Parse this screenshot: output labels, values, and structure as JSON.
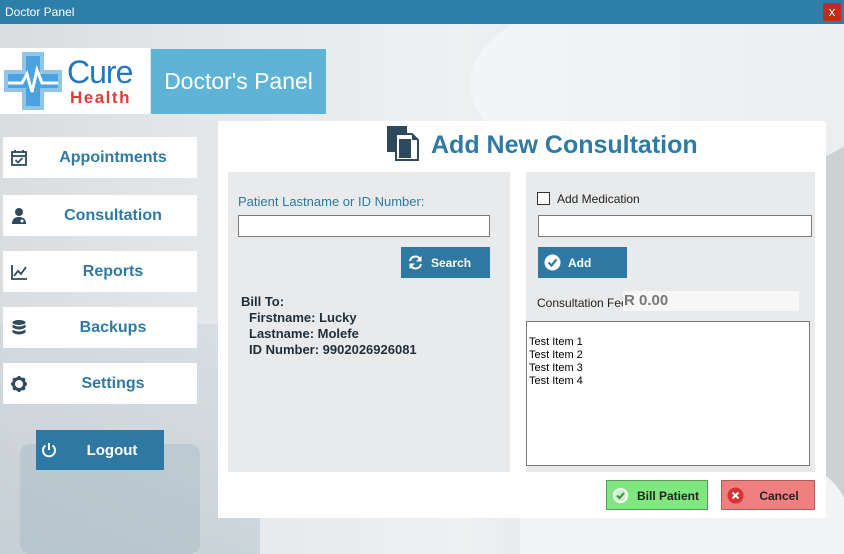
{
  "window": {
    "title": "Doctor Panel",
    "close": "x"
  },
  "logo": {
    "line1": "Cure",
    "line2": "Health"
  },
  "panel_title": "Doctor's Panel",
  "nav": {
    "appointments": "Appointments",
    "consultation": "Consultation",
    "reports": "Reports",
    "backups": "Backups",
    "settings": "Settings",
    "logout": "Logout"
  },
  "main": {
    "heading": "Add New Consultation",
    "search": {
      "label": "Patient Lastname or ID Number:",
      "value": "",
      "button": "Search"
    },
    "bill": {
      "title": "Bill To:",
      "firstname": "Firstname: Lucky",
      "lastname": "Lastname: Molefe",
      "id_number": "ID Number: 9902026926081"
    },
    "medication": {
      "checkbox_label": "Add Medication",
      "checked": false,
      "value": "",
      "add_button": "Add",
      "fee_label": "Consultation Fee:",
      "fee_value": "R 0.00",
      "items": [
        "Test Item 1",
        "Test Item 2",
        "Test Item 3",
        "Test Item 4"
      ]
    },
    "bill_patient": "Bill Patient",
    "cancel": "Cancel"
  },
  "colors": {
    "titlebar": "#2b7fa8",
    "accent": "#2e7aa3",
    "panel_title_bg": "#5fb3d6",
    "bill_button": "#7ee87e",
    "cancel_button": "#f08080"
  },
  "icons": {
    "appointments": "calendar-check-icon",
    "consultation": "doctor-icon",
    "reports": "line-chart-icon",
    "backups": "database-icon",
    "settings": "gear-icon",
    "logout": "power-icon",
    "heading": "documents-icon",
    "search": "refresh-icon",
    "add": "check-circle-icon",
    "bill": "check-circle-icon",
    "cancel": "close-circle-icon"
  }
}
